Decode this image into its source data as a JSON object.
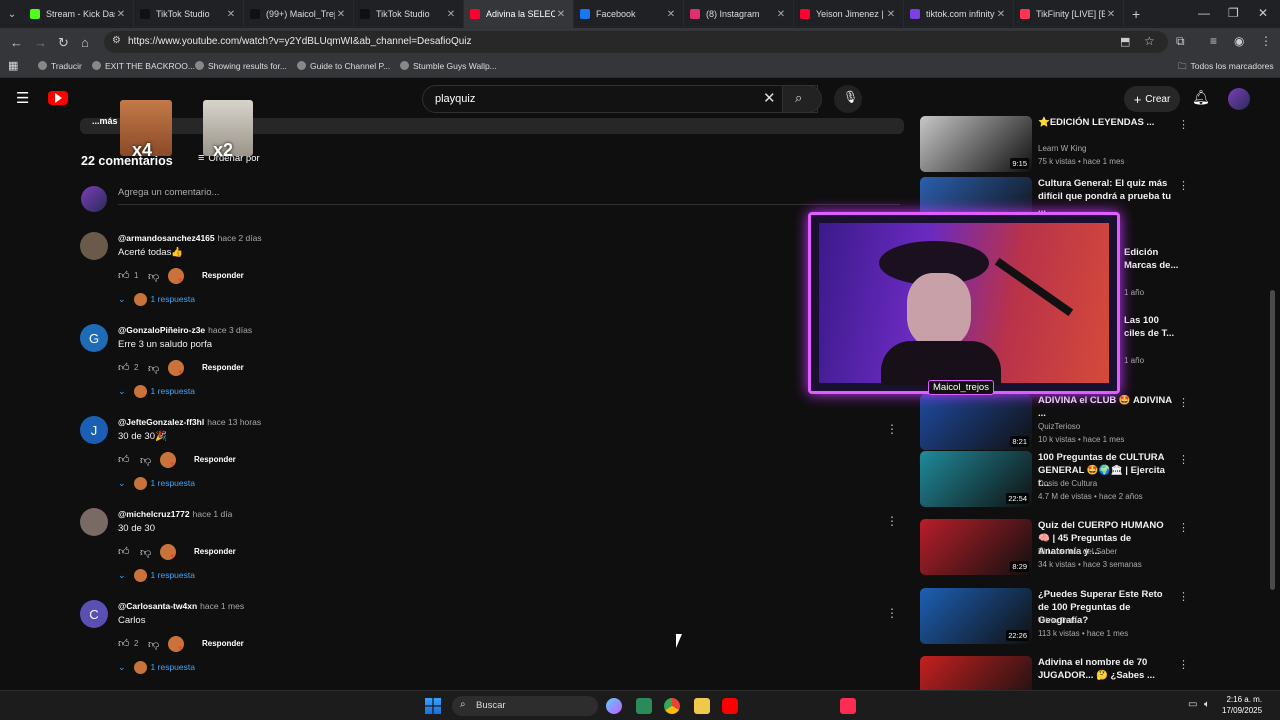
{
  "browser": {
    "tabs": [
      {
        "title": "Stream - Kick Das",
        "color": "#53fc18"
      },
      {
        "title": "TikTok Studio",
        "color": "#111111"
      },
      {
        "title": "(99+) Maicol_Trej",
        "color": "#111111"
      },
      {
        "title": "TikTok Studio",
        "color": "#111111"
      },
      {
        "title": "Adivina la SELECC",
        "color": "#ff0033",
        "active": true
      },
      {
        "title": "Facebook",
        "color": "#1877f2"
      },
      {
        "title": "(8) Instagram",
        "color": "#e1306c"
      },
      {
        "title": "Yeison Jimenez | L",
        "color": "#ff0033"
      },
      {
        "title": "tiktok.com infinity",
        "color": "#7b3fe4"
      },
      {
        "title": "TikFinity [LIVE] [B",
        "color": "#ff3355"
      }
    ],
    "url": "https://www.youtube.com/watch?v=y2YdBLUqmWI&ab_channel=DesafioQuiz",
    "bookmarks": [
      "Traducir",
      "EXIT THE BACKROO...",
      "Showing results for...",
      "Guide to Channel P...",
      "Stumble Guys Wallp..."
    ],
    "all_bookmarks": "Todos los marcadores"
  },
  "youtube": {
    "search_value": "playquiz",
    "create_label": "Crear",
    "more_label": "...más",
    "comments_count": "22 comentarios",
    "sort_label": "Ordenar por",
    "add_comment_placeholder": "Agrega un comentario...",
    "reply_label": "Responder",
    "comments": [
      {
        "handle": "@armandosanchez4165",
        "time": "hace 2 días",
        "text": "Acerté todas👍",
        "likes": "1",
        "replies": "1 respuesta",
        "avatar_letter": "",
        "avatar_color": "#6a5a4a"
      },
      {
        "handle": "@GonzaloPiñeiro-z3e",
        "time": "hace 3 días",
        "text": "Erre 3 un saludo porfa",
        "likes": "2",
        "replies": "1 respuesta",
        "avatar_letter": "G",
        "avatar_color": "#1e6bb8"
      },
      {
        "handle": "@JefteGonzalez-ff3hl",
        "time": "hace 13 horas",
        "text": "30 de 30🎉",
        "likes": "",
        "replies": "1 respuesta",
        "avatar_letter": "J",
        "avatar_color": "#1a5fb4"
      },
      {
        "handle": "@michelcruz1772",
        "time": "hace 1 día",
        "text": "30 de 30",
        "likes": "",
        "replies": "1 respuesta",
        "avatar_letter": "",
        "avatar_color": "#7a6a66"
      },
      {
        "handle": "@Carlosanta-tw4xn",
        "time": "hace 1 mes",
        "text": "Carlos",
        "likes": "2",
        "replies": "1 respuesta",
        "avatar_letter": "C",
        "avatar_color": "#5a4fb4"
      }
    ],
    "recommended": [
      {
        "title": "⭐EDICIÓN LEYENDAS ...",
        "channel": "Learn W King",
        "meta": "75 k vistas • hace 1 mes",
        "duration": "9:15",
        "thumb": "#c7c7c7"
      },
      {
        "title": "Cultura General: El quiz más difícil que pondrá a prueba tu ...",
        "channel": "",
        "meta": "",
        "duration": "",
        "thumb": "#2b5fae"
      },
      {
        "title": "ADIVINA el CLUB 🤩 ADIVINA ...",
        "channel": "QuizTerioso",
        "meta": "10 k vistas • hace 1 mes",
        "duration": "8:21",
        "thumb": "#1f4aa0"
      },
      {
        "title": "100 Preguntas de CULTURA GENERAL 🤩🌍🏛 | Ejercita t...",
        "channel": "Dosis de Cultura",
        "meta": "4.7 M de vistas • hace 2 años",
        "duration": "22:54",
        "thumb": "#1f8a9a"
      },
      {
        "title": "Quiz del CUERPO HUMANO 🧠 | 45 Preguntas de Anatomía y ...",
        "channel": "El Laberinto del Saber",
        "meta": "34 k vistas • hace 3 semanas",
        "duration": "8:29",
        "thumb": "#b81e2a"
      },
      {
        "title": "¿Puedes Superar Este Reto de 100 Preguntas de Geografía?",
        "channel": "Trivia Time",
        "meta": "113 k vistas • hace 1 mes",
        "duration": "22:26",
        "thumb": "#1d5fb4"
      },
      {
        "title": "Adivina el nombre de 70 JUGADOR... 🤔 ¿Sabes ...",
        "channel": "",
        "meta": "",
        "duration": "",
        "thumb": "#c42020"
      }
    ],
    "partial_recs": [
      {
        "title": "Edición Marcas de...",
        "meta": "1 año"
      },
      {
        "title": "Las 100 ciles de T...",
        "meta": "1 año"
      }
    ]
  },
  "overlay": {
    "streamer_name": "Maicol_trejos",
    "sticker_1": "x4",
    "sticker_2": "x2"
  },
  "taskbar": {
    "search_label": "Buscar",
    "time": "2:16 a. m.",
    "date": "17/09/2025"
  }
}
